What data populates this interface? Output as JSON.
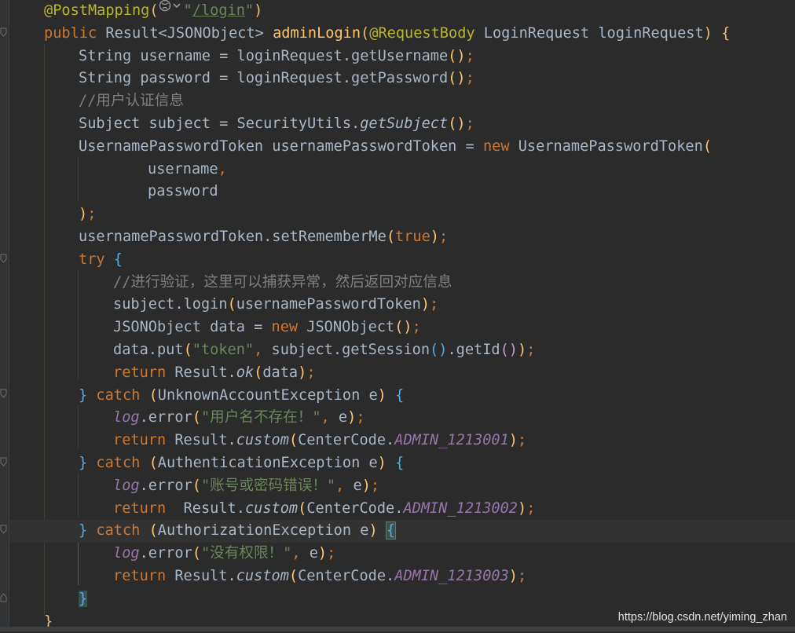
{
  "code": {
    "ann": "@PostMapping",
    "route": "/login",
    "sig_public": "public",
    "sig_type": "Result",
    "sig_generic": "<JSONObject>",
    "sig_name": "adminLogin",
    "sig_param_ann": "@RequestBody",
    "sig_param": "LoginRequest loginRequest",
    "l2": "String username = loginRequest.getUsername",
    "l3": "String password = loginRequest.getPassword",
    "l4_comment": "//用户认证信息",
    "l5a": "Subject subject = SecurityUtils.",
    "l5b": "getSubject",
    "l6a": "UsernamePasswordToken usernamePasswordToken = ",
    "kw_new": "new",
    "l6b": " UsernamePasswordToken",
    "l7": "username",
    "l8": "password",
    "l10a": "usernamePasswordToken.setRememberMe",
    "l10b": "true",
    "kw_try": "try",
    "l12_comment": "//进行验证，这里可以捕获异常，然后返回对应信息",
    "l13a": "subject.login",
    "l13b": "usernamePasswordToken",
    "l14a": "JSONObject data = ",
    "l14b": " JSONObject",
    "l15a": "data.put",
    "l15str": "\"token\"",
    "l15b": " subject.getSession",
    "l15c": ".getId",
    "kw_return": "return",
    "result": " Result.",
    "ok": "ok",
    "data_arg": "data",
    "kw_catch": "catch",
    "exc1": "UnknownAccountException e",
    "exc2": "AuthenticationException e",
    "exc3": "AuthorizationException e",
    "log": "log",
    "error": ".error",
    "msg1": "\"用户名不存在！\"",
    "msg2": "\"账号或密码错误！\"",
    "msg3": "\"没有权限！\"",
    "e_arg": " e",
    "custom": "custom",
    "center": "CenterCode.",
    "code1": "ADMIN_1213001",
    "code2": "ADMIN_1213002",
    "code3": "ADMIN_1213003"
  },
  "watermark": "https://blog.csdn.net/yiming_zhan",
  "colors": {
    "background": "#2b2b2b",
    "keyword": "#cc7832",
    "string": "#6a8759",
    "function": "#ffc66d",
    "annotation": "#bbb529",
    "comment": "#808080",
    "constant": "#9876aa"
  }
}
